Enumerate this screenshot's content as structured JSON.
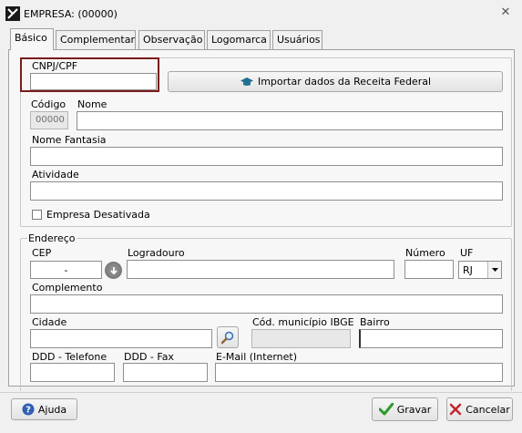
{
  "window": {
    "title": "EMPRESA: (00000)"
  },
  "tabs": [
    {
      "label": "Básico"
    },
    {
      "label": "Complementar"
    },
    {
      "label": "Observação"
    },
    {
      "label": "Logomarca"
    },
    {
      "label": "Usuários"
    }
  ],
  "basic": {
    "cnpj_label": "CNPJ/CPF",
    "cnpj_value": "",
    "import_button": "Importar dados da Receita Federal",
    "codigo_label": "Código",
    "codigo_value": "00000",
    "nome_label": "Nome",
    "nome_value": "",
    "fantasia_label": "Nome Fantasia",
    "atividade_label": "Atividade",
    "desativada_label": "Empresa Desativada",
    "desativada_checked": false
  },
  "address": {
    "group_label": "Endereço",
    "cep_label": "CEP",
    "cep_value": "-",
    "logradouro_label": "Logradouro",
    "numero_label": "Número",
    "uf_label": "UF",
    "uf_value": "RJ",
    "complemento_label": "Complemento",
    "cidade_label": "Cidade",
    "ibge_label": "Cód. município IBGE",
    "bairro_label": "Bairro",
    "telefone_label": "DDD - Telefone",
    "fax_label": "DDD - Fax",
    "email_label": "E-Mail (Internet)"
  },
  "footer": {
    "help_button": "Ajuda",
    "save_button": "Gravar",
    "cancel_button": "Cancelar"
  },
  "colors": {
    "highlight_border": "#7a1c1c",
    "save_check": "#2a9a2a",
    "cancel_x": "#c0262c",
    "help_icon": "#2f5fb3"
  }
}
